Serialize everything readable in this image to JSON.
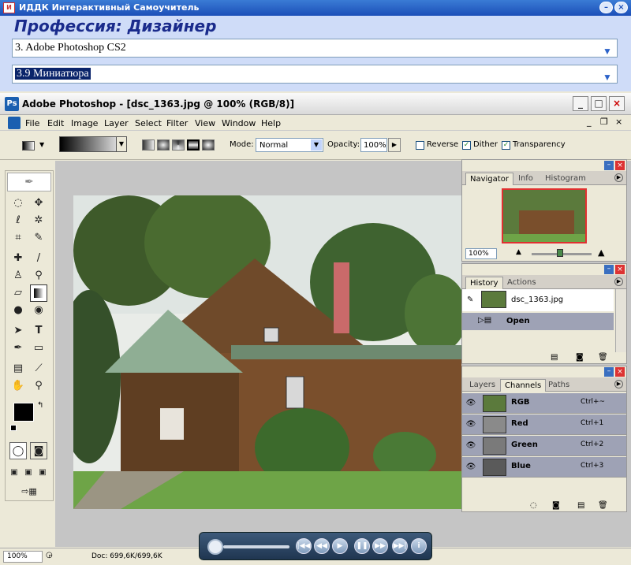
{
  "outer_window": {
    "title": "ИДДК Интерактивный Самоучитель"
  },
  "trainer": {
    "course_title": "Профессия: Дизайнер",
    "module_select": "3. Adobe Photoshop CS2",
    "lesson_select": "3.9 Миниатюра"
  },
  "ps_window": {
    "title": "Adobe Photoshop - [dsc_1363.jpg @ 100% (RGB/8)]"
  },
  "menu": [
    "File",
    "Edit",
    "Image",
    "Layer",
    "Select",
    "Filter",
    "View",
    "Window",
    "Help"
  ],
  "options": {
    "mode_label": "Mode:",
    "mode_value": "Normal",
    "opacity_label": "Opacity:",
    "opacity_value": "100%",
    "reverse_label": "Reverse",
    "dither_label": "Dither",
    "transparency_label": "Transparency",
    "reverse_checked": false,
    "dither_checked": true,
    "transparency_checked": true
  },
  "navigator": {
    "tabs": [
      "Navigator",
      "Info",
      "Histogram"
    ],
    "zoom": "100%"
  },
  "history": {
    "tabs": [
      "History",
      "Actions"
    ],
    "snapshot": "dsc_1363.jpg",
    "step": "Open"
  },
  "layers": {
    "tabs": [
      "Layers",
      "Channels",
      "Paths"
    ],
    "channels": [
      {
        "name": "RGB",
        "shortcut": "Ctrl+~"
      },
      {
        "name": "Red",
        "shortcut": "Ctrl+1"
      },
      {
        "name": "Green",
        "shortcut": "Ctrl+2"
      },
      {
        "name": "Blue",
        "shortcut": "Ctrl+3"
      }
    ]
  },
  "status": {
    "zoom": "100%",
    "doc": "Doc: 699,6K/699,6K"
  },
  "colors": {
    "xp_title": "#1c4fb8",
    "trainer_bg": "#cfdcf8",
    "course_title": "#1a2b8c",
    "selection": "#0a246a"
  }
}
